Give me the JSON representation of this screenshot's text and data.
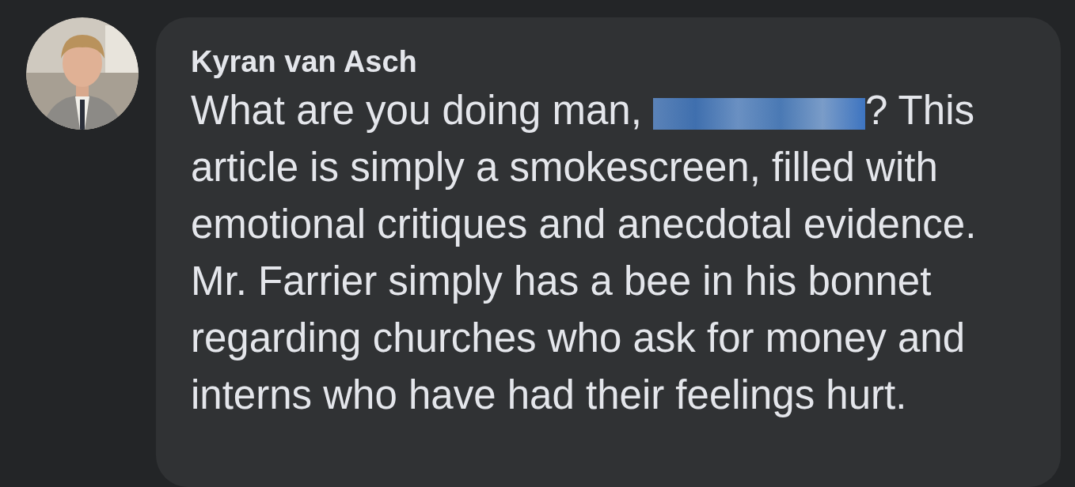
{
  "comment": {
    "author": "Kyran van Asch",
    "text_before": "What are you doing man, ",
    "redacted": true,
    "text_after": "? This article is simply a smokescreen, filled with emotional critiques and anecdotal evidence. Mr. Farrier simply has a bee in his bonnet regarding churches who ask for money and interns who have had their feelings hurt."
  }
}
